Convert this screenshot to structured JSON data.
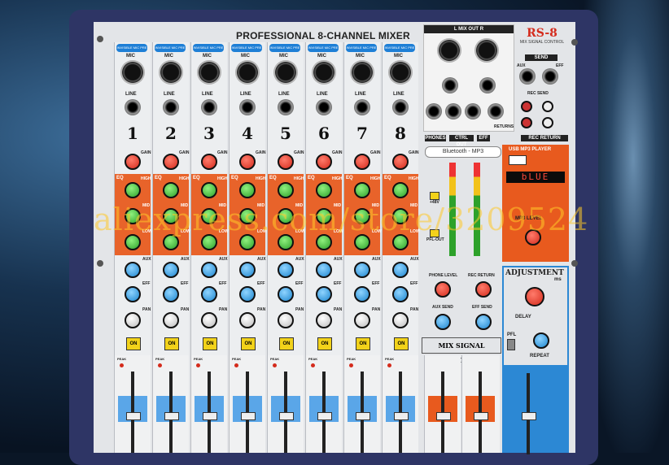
{
  "image": {
    "title": "PROFESSIONAL 8-CHANNEL MIXER",
    "brand_model": "RS-8",
    "brand_subtitle": "MIX SIGNAL CONTROL",
    "channel_numbers": [
      "1",
      "2",
      "3",
      "4",
      "5",
      "6",
      "7",
      "8"
    ],
    "channel_labels": {
      "mic": "MIC",
      "line": "LINE",
      "gain": "GAIN",
      "eq": "EQ",
      "high": "HIGH",
      "mid": "MID",
      "low": "LOW",
      "aux": "AUX",
      "eff": "EFF",
      "pan": "PAN",
      "on": "ON",
      "peak": "PEAK",
      "phantom_tag": "INVISIBLE MIC PRE"
    },
    "mix_out_label": "L   MIX OUT   R",
    "send_label": "SEND",
    "aux_label": "AUX",
    "eff_label": "EFF",
    "rec_send_label": "REC SEND",
    "rec_return_label": "REC RETURN",
    "phones_label": "PHONES",
    "ctrl_out_label": "CTRL OUT",
    "eff_row_label": "EFF",
    "returns_label": "RETURNS",
    "bluetooth_label": "Bluetooth - MP3",
    "usb_player_label": "USB  MP3 PLAYER",
    "display_text": "bLUE",
    "mp3_level_label": "MP3 LEVEL",
    "adjustment_label": "ADJUSTMENT",
    "adjustment_unit": "ms",
    "delay_label": "DELAY",
    "repeat_label": "REPEAT",
    "pfl_label": "PFL",
    "phone_level_label": "PHONE LEVEL",
    "rec_return_knob_label": "REC RETURN",
    "aux_send_label": "AUX SEND",
    "eff_send_label": "EFF SEND",
    "mix_signal_control_label": "MIX SIGNAL CONTROL",
    "v48_label": "+48V",
    "pflcut_label": "PFL-OUT",
    "watermark": "aliexpress.com/store/3209524",
    "colors": {
      "faceplate": "#e3e5e8",
      "frame": "#2e3565",
      "eq_section": "#e8632a",
      "accent_blue": "#2c88d4",
      "knob_red": "#d42b1c",
      "knob_green": "#2da12a",
      "knob_blue": "#1e86cf",
      "on_button": "#f2d21a",
      "watermark": "#ffc828"
    }
  }
}
